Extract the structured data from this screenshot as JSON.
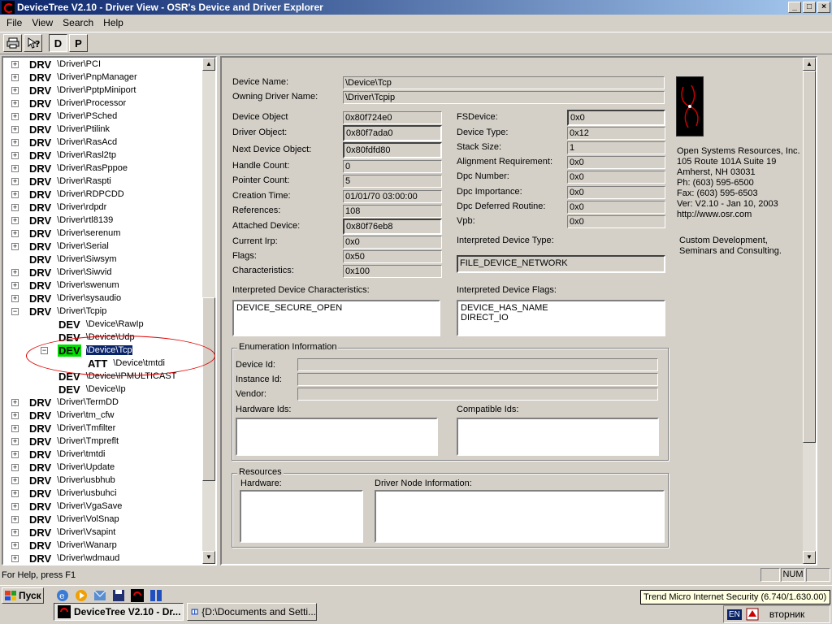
{
  "window": {
    "title": "DeviceTree V2.10 - Driver View - OSR's Device and Driver Explorer",
    "controls": {
      "minimize": "_",
      "maximize": "□",
      "close": "×"
    }
  },
  "menu": [
    "File",
    "View",
    "Search",
    "Help"
  ],
  "toolbar": {
    "d_label": "D",
    "p_label": "P"
  },
  "tree": {
    "rows": [
      {
        "tag": "DRV",
        "path": "\\Driver\\PCI",
        "exp": "+"
      },
      {
        "tag": "DRV",
        "path": "\\Driver\\PnpManager",
        "exp": "+"
      },
      {
        "tag": "DRV",
        "path": "\\Driver\\PptpMiniport",
        "exp": "+"
      },
      {
        "tag": "DRV",
        "path": "\\Driver\\Processor",
        "exp": "+"
      },
      {
        "tag": "DRV",
        "path": "\\Driver\\PSched",
        "exp": "+"
      },
      {
        "tag": "DRV",
        "path": "\\Driver\\Ptilink",
        "exp": "+"
      },
      {
        "tag": "DRV",
        "path": "\\Driver\\RasAcd",
        "exp": "+"
      },
      {
        "tag": "DRV",
        "path": "\\Driver\\Rasl2tp",
        "exp": "+"
      },
      {
        "tag": "DRV",
        "path": "\\Driver\\RasPppoe",
        "exp": "+"
      },
      {
        "tag": "DRV",
        "path": "\\Driver\\Raspti",
        "exp": "+"
      },
      {
        "tag": "DRV",
        "path": "\\Driver\\RDPCDD",
        "exp": "+"
      },
      {
        "tag": "DRV",
        "path": "\\Driver\\rdpdr",
        "exp": "+"
      },
      {
        "tag": "DRV",
        "path": "\\Driver\\rtl8139",
        "exp": "+"
      },
      {
        "tag": "DRV",
        "path": "\\Driver\\serenum",
        "exp": "+"
      },
      {
        "tag": "DRV",
        "path": "\\Driver\\Serial",
        "exp": "+"
      },
      {
        "tag": "DRV",
        "path": "\\Driver\\Siwsym",
        "exp": ""
      },
      {
        "tag": "DRV",
        "path": "\\Driver\\Siwvid",
        "exp": "+"
      },
      {
        "tag": "DRV",
        "path": "\\Driver\\swenum",
        "exp": "+"
      },
      {
        "tag": "DRV",
        "path": "\\Driver\\sysaudio",
        "exp": "+"
      },
      {
        "tag": "DRV",
        "path": "\\Driver\\Tcpip",
        "exp": "−"
      },
      {
        "tag": "DEV",
        "path": "\\Device\\RawIp",
        "exp": "",
        "level": 1
      },
      {
        "tag": "DEV",
        "path": "\\Device\\Udp",
        "exp": "",
        "level": 1
      },
      {
        "tag": "DEV",
        "path": "\\Device\\Tcp",
        "exp": "−",
        "level": 1,
        "selected": true
      },
      {
        "tag": "ATT",
        "path": "\\Device\\tmtdi",
        "exp": "",
        "level": 2
      },
      {
        "tag": "DEV",
        "path": "\\Device\\IPMULTICAST",
        "exp": "",
        "level": 1
      },
      {
        "tag": "DEV",
        "path": "\\Device\\Ip",
        "exp": "",
        "level": 1
      },
      {
        "tag": "DRV",
        "path": "\\Driver\\TermDD",
        "exp": "+"
      },
      {
        "tag": "DRV",
        "path": "\\Driver\\tm_cfw",
        "exp": "+"
      },
      {
        "tag": "DRV",
        "path": "\\Driver\\Tmfilter",
        "exp": "+"
      },
      {
        "tag": "DRV",
        "path": "\\Driver\\Tmpreflt",
        "exp": "+"
      },
      {
        "tag": "DRV",
        "path": "\\Driver\\tmtdi",
        "exp": "+"
      },
      {
        "tag": "DRV",
        "path": "\\Driver\\Update",
        "exp": "+"
      },
      {
        "tag": "DRV",
        "path": "\\Driver\\usbhub",
        "exp": "+"
      },
      {
        "tag": "DRV",
        "path": "\\Driver\\usbuhci",
        "exp": "+"
      },
      {
        "tag": "DRV",
        "path": "\\Driver\\VgaSave",
        "exp": "+"
      },
      {
        "tag": "DRV",
        "path": "\\Driver\\VolSnap",
        "exp": "+"
      },
      {
        "tag": "DRV",
        "path": "\\Driver\\Vsapint",
        "exp": "+"
      },
      {
        "tag": "DRV",
        "path": "\\Driver\\Wanarp",
        "exp": "+"
      },
      {
        "tag": "DRV",
        "path": "\\Driver\\wdmaud",
        "exp": "+"
      }
    ]
  },
  "details": {
    "device_name_label": "Device Name:",
    "device_name": "\\Device\\Tcp",
    "owning_driver_label": "Owning Driver Name:",
    "owning_driver": "\\Driver\\Tcpip",
    "left_fields": [
      {
        "label": "Device Object",
        "value": "0x80f724e0",
        "raised": false
      },
      {
        "label": "Driver Object:",
        "value": "0x80f7ada0",
        "raised": true
      },
      {
        "label": "Next Device Object:",
        "value": "0x80fdfd80",
        "raised": true
      },
      {
        "label": "Handle Count:",
        "value": "0",
        "raised": false
      },
      {
        "label": "Pointer Count:",
        "value": "5",
        "raised": false
      },
      {
        "label": "Creation Time:",
        "value": "01/01/70 03:00:00",
        "raised": false
      },
      {
        "label": "References:",
        "value": "108",
        "raised": false
      },
      {
        "label": "Attached Device:",
        "value": "0x80f76eb8",
        "raised": true
      },
      {
        "label": "Current Irp:",
        "value": "0x0",
        "raised": false
      },
      {
        "label": "Flags:",
        "value": "0x50",
        "raised": false
      },
      {
        "label": "Characteristics:",
        "value": "0x100",
        "raised": false
      }
    ],
    "right_fields": [
      {
        "label": "FSDevice:",
        "value": "0x0",
        "raised": true
      },
      {
        "label": "Device Type:",
        "value": "0x12",
        "raised": false
      },
      {
        "label": "Stack Size:",
        "value": "1",
        "raised": false
      },
      {
        "label": "Alignment Requirement:",
        "value": "0x0",
        "raised": false
      },
      {
        "label": "Dpc Number:",
        "value": "0x0",
        "raised": false
      },
      {
        "label": "Dpc Importance:",
        "value": "0x0",
        "raised": false
      },
      {
        "label": "Dpc Deferred Routine:",
        "value": "0x0",
        "raised": false
      },
      {
        "label": "Vpb:",
        "value": "0x0",
        "raised": false
      }
    ],
    "interpreted_type_label": "Interpreted Device Type:",
    "interpreted_type": "FILE_DEVICE_NETWORK",
    "interpreted_chars_label": "Interpreted Device Characteristics:",
    "interpreted_chars": "DEVICE_SECURE_OPEN",
    "interpreted_flags_label": "Interpreted Device Flags:",
    "interpreted_flags": "DEVICE_HAS_NAME\nDIRECT_IO",
    "enum_group_title": "Enumeration Information",
    "device_id_label": "Device Id:",
    "instance_id_label": "Instance Id:",
    "vendor_label": "Vendor:",
    "hardware_ids_label": "Hardware Ids:",
    "compatible_ids_label": "Compatible Ids:",
    "resources_group_title": "Resources",
    "hardware_label": "Hardware:",
    "driver_node_label": "Driver Node Information:"
  },
  "osr": {
    "company": "Open Systems Resources, Inc.",
    "address1": "105 Route 101A Suite 19",
    "address2": "Amherst, NH 03031",
    "phone": "Ph:  (603) 595-6500",
    "fax": "Fax: (603) 595-6503",
    "version": "Ver: V2.10 - Jan 10, 2003",
    "url": "http://www.osr.com",
    "tagline1": "Custom Development,",
    "tagline2": "Seminars and Consulting."
  },
  "status": {
    "help": "For Help, press F1",
    "num": "NUM"
  },
  "taskbar": {
    "start": "Пуск",
    "tasks": [
      {
        "label": "DeviceTree V2.10 - Dr...",
        "active": true
      },
      {
        "label": "{D:\\Documents and Setti...",
        "active": false
      }
    ],
    "lang": "EN",
    "clock": "вторник",
    "tooltip": "Trend Micro Internet Security (6.740/1.630.00)"
  },
  "colors": {
    "title_start": "#0a246a",
    "title_end": "#a6caf0",
    "selection_tag": "#00e000",
    "ellipse": "#dd0000"
  }
}
